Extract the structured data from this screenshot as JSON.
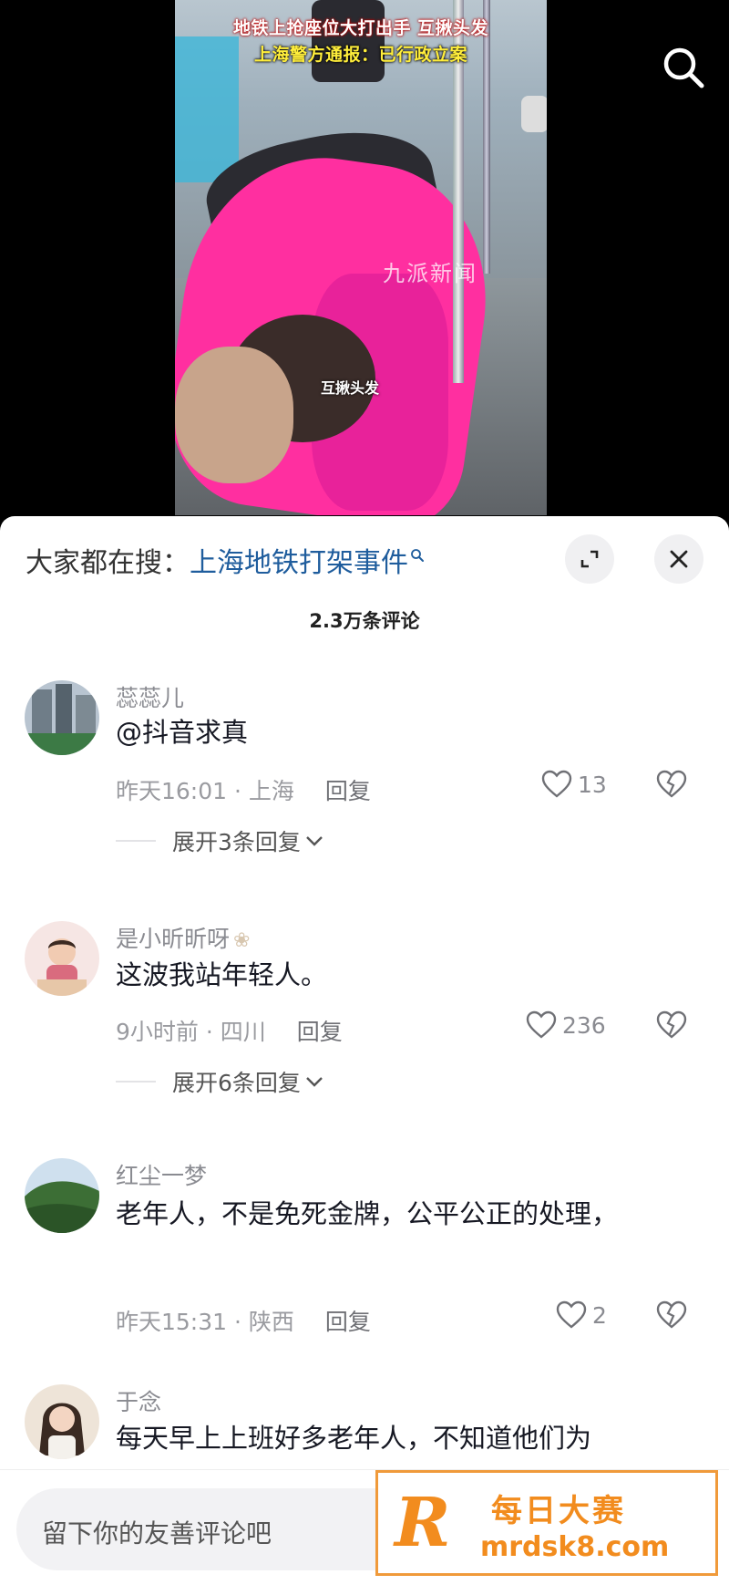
{
  "video": {
    "headline_line1": "地铁上抢座位大打出手 互揪头发",
    "headline_line2": "上海警方通报：已行政立案",
    "watermark": "九派新闻",
    "subtitle": "互揪头发"
  },
  "panel": {
    "search_prefix": "大家都在搜：",
    "search_term": "上海地铁打架事件",
    "comment_count": "2.3万条评论"
  },
  "comments": [
    {
      "author": "蕊蕊儿",
      "text": "@抖音求真",
      "time_location": "昨天16:01 · 上海",
      "reply": "回复",
      "likes": "13",
      "expand": "展开3条回复"
    },
    {
      "author": "是小昕昕呀",
      "text": "这波我站年轻人。",
      "time_location": "9小时前 · 四川",
      "reply": "回复",
      "likes": "236",
      "expand": "展开6条回复"
    },
    {
      "author": "红尘一梦",
      "text": "老年人，不是免死金牌，公平公正的处理，",
      "time_location": "昨天15:31 · 陕西",
      "reply": "回复",
      "likes": "2"
    },
    {
      "author": "于念",
      "text": "每天早上上班好多老年人，不知道他们为"
    }
  ],
  "input": {
    "placeholder": "留下你的友善评论吧"
  },
  "ad": {
    "logo": "R",
    "name": "每日大赛",
    "url": "mrdsk8.com"
  },
  "colors": {
    "accent_link": "#1f5d9d",
    "video_pink": "#ff2fa0",
    "headline_yellow": "#ffee3b",
    "ad_orange": "#f28c1e"
  },
  "icons": [
    "search-icon",
    "expand-icon",
    "close-icon",
    "heart-icon",
    "broken-heart-icon",
    "chevron-down-icon",
    "image-icon",
    "at-icon",
    "emoji-icon"
  ]
}
